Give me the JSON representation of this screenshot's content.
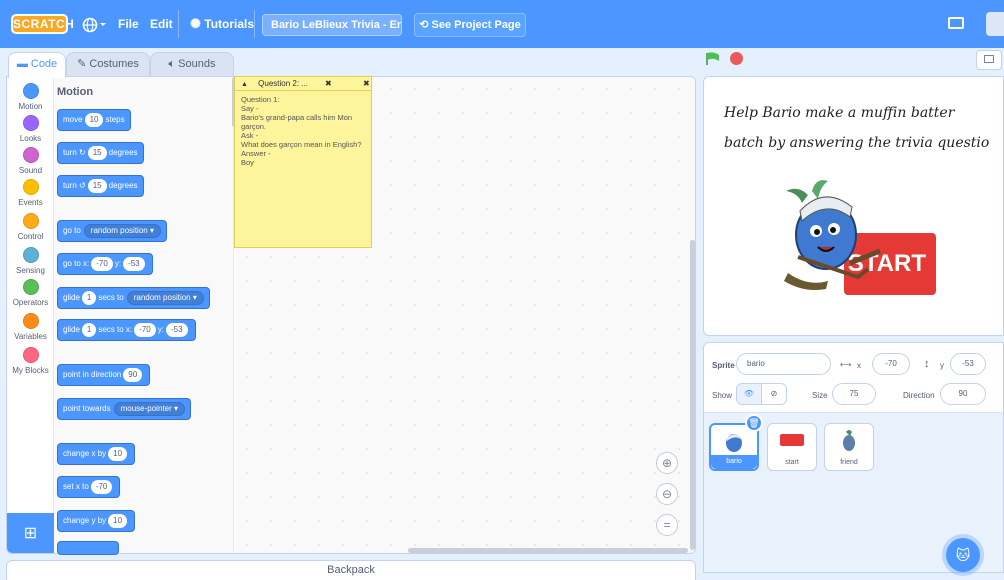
{
  "menubar": {
    "logo": "SCRATCH",
    "file": "File",
    "edit": "Edit",
    "tutorials": "Tutorials",
    "project_title": "Bario LeBlieux Trivia - Eng...",
    "see_project": "See Project Page"
  },
  "tabs": {
    "code": "Code",
    "costumes": "Costumes",
    "sounds": "Sounds"
  },
  "categories": [
    {
      "label": "Motion",
      "color": "#4c97ff"
    },
    {
      "label": "Looks",
      "color": "#9966ff"
    },
    {
      "label": "Sound",
      "color": "#cf63cf"
    },
    {
      "label": "Events",
      "color": "#ffbf00"
    },
    {
      "label": "Control",
      "color": "#ffab19"
    },
    {
      "label": "Sensing",
      "color": "#5cb1d6"
    },
    {
      "label": "Operators",
      "color": "#59c059"
    },
    {
      "label": "Variables",
      "color": "#ff8c1a"
    },
    {
      "label": "My Blocks",
      "color": "#ff6680"
    }
  ],
  "palette": {
    "title": "Motion",
    "move": {
      "a": "move",
      "n": "10",
      "b": "steps"
    },
    "turn_right": {
      "a": "turn",
      "n": "15",
      "b": "degrees"
    },
    "turn_left": {
      "a": "turn",
      "n": "15",
      "b": "degrees"
    },
    "goto": {
      "a": "go to",
      "dd": "random position"
    },
    "goto_xy": {
      "a": "go to x:",
      "x": "-70",
      "b": "y:",
      "y": "-53"
    },
    "glide_random": {
      "a": "glide",
      "n": "1",
      "b": "secs to",
      "dd": "random position"
    },
    "glide_xy": {
      "a": "glide",
      "n": "1",
      "b": "secs to x:",
      "x": "-70",
      "c": "y:",
      "y": "-53"
    },
    "point_dir": {
      "a": "point in direction",
      "n": "90"
    },
    "point_towards": {
      "a": "point towards",
      "dd": "mouse-pointer"
    },
    "change_x": {
      "a": "change x by",
      "n": "10"
    },
    "set_x": {
      "a": "set x to",
      "n": "-70"
    },
    "change_y": {
      "a": "change y by",
      "n": "10"
    }
  },
  "comment": {
    "title": "Question 2: ...",
    "body": "Question 1:\nSay -\nBario's grand-papa calls him Mon garçon.\nAsk -\n  What does garçon mean in English?\nAnswer -\nBoy"
  },
  "backpack": "Backpack",
  "stage": {
    "line1": "Help Bario make a muffin batter",
    "line2": "batch by answering the trivia questio",
    "start_label": "START"
  },
  "sprite_info": {
    "sprite_label": "Sprite",
    "sprite_name": "bario",
    "x_label": "x",
    "x": "-70",
    "y_label": "y",
    "y": "-53",
    "show_label": "Show",
    "size_label": "Size",
    "size": "75",
    "direction_label": "Direction",
    "direction": "90"
  },
  "sprites": [
    {
      "name": "bario"
    },
    {
      "name": "start"
    },
    {
      "name": "friend"
    }
  ],
  "colors": {
    "accent": "#4c97ff",
    "motion": "#4c97ff",
    "comment": "#fef49c"
  }
}
